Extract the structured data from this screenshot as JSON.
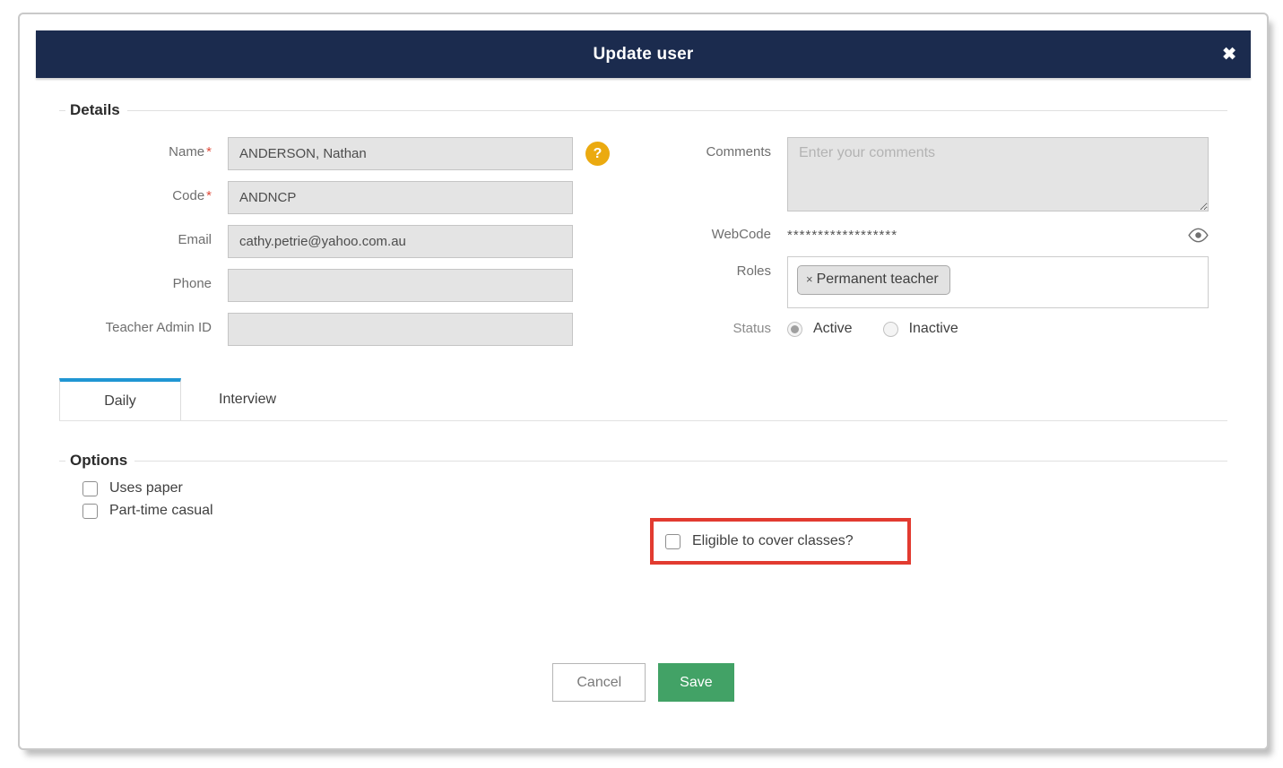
{
  "modal": {
    "title": "Update user",
    "close_icon": "✖"
  },
  "details": {
    "legend": "Details",
    "help_icon": "?",
    "fields": {
      "name": {
        "label": "Name",
        "required": "*",
        "value": "ANDERSON, Nathan"
      },
      "code": {
        "label": "Code",
        "required": "*",
        "value": "ANDNCP"
      },
      "email": {
        "label": "Email",
        "value": "cathy.petrie@yahoo.com.au"
      },
      "phone": {
        "label": "Phone",
        "value": ""
      },
      "teacher_admin_id": {
        "label": "Teacher Admin ID",
        "value": ""
      },
      "comments": {
        "label": "Comments",
        "value": "",
        "placeholder": "Enter your comments"
      },
      "webcode": {
        "label": "WebCode",
        "masked_value": "******************",
        "eye_icon": "eye"
      },
      "roles": {
        "label": "Roles",
        "tags": [
          {
            "remove": "×",
            "label": "Permanent teacher"
          }
        ]
      },
      "status": {
        "label": "Status",
        "options": [
          {
            "label": "Active",
            "selected": true
          },
          {
            "label": "Inactive",
            "selected": false
          }
        ]
      }
    }
  },
  "tabs": [
    {
      "label": "Daily",
      "active": true
    },
    {
      "label": "Interview",
      "active": false
    }
  ],
  "options": {
    "legend": "Options",
    "checkboxes": [
      {
        "label": "Uses paper",
        "checked": false,
        "highlighted": false
      },
      {
        "label": "Part-time casual",
        "checked": false,
        "highlighted": false
      },
      {
        "label": "Eligible to cover classes?",
        "checked": false,
        "highlighted": true
      }
    ]
  },
  "footer": {
    "cancel_label": "Cancel",
    "save_label": "Save"
  },
  "colors": {
    "header_bg": "#1b2b4e",
    "tab_active_accent": "#2096d3",
    "save_button_bg": "#42a266",
    "highlight_border": "#e23b30",
    "help_icon_bg": "#ebaa10",
    "input_bg": "#e4e4e4"
  }
}
